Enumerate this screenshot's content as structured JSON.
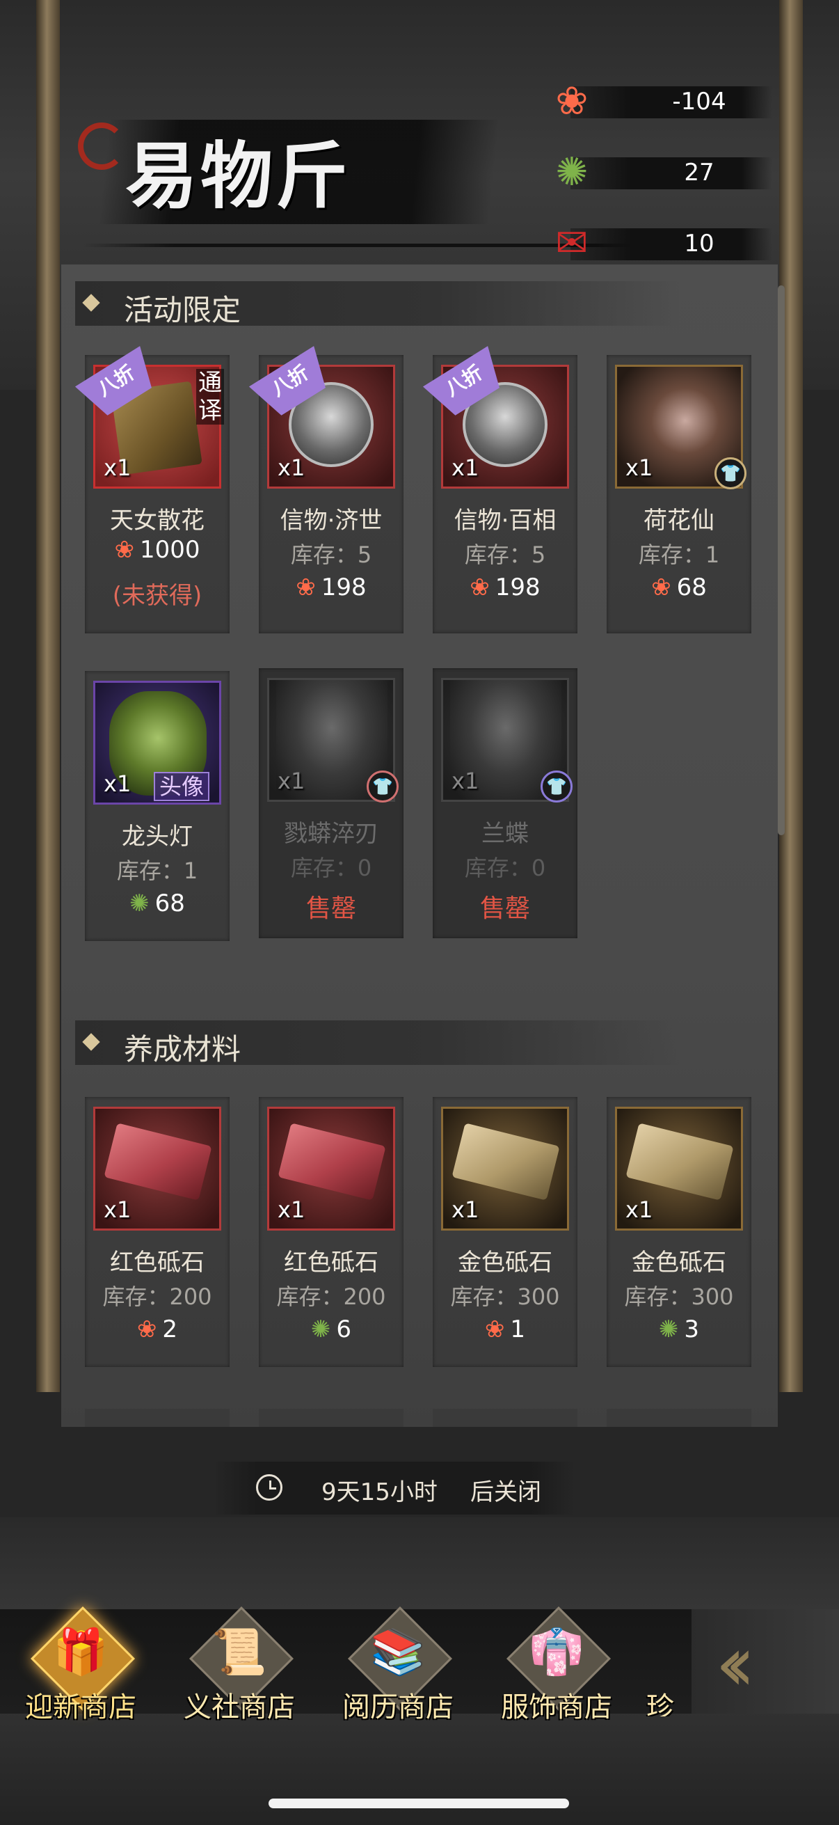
{
  "header": {
    "title": "易物斤"
  },
  "currencies": [
    {
      "icon": "lotus-icon",
      "value": "-104"
    },
    {
      "icon": "dragon-token-icon",
      "value": "27"
    },
    {
      "icon": "fortune-bag-icon",
      "value": "10"
    }
  ],
  "sections": {
    "limited": {
      "title": "活动限定"
    },
    "materials": {
      "title": "养成材料"
    }
  },
  "limited_items": [
    {
      "name": "天女散花",
      "qty": "x1",
      "badge": "八折",
      "side_label": "通译",
      "price": "1000",
      "currency": "lotus",
      "note": "(未获得)"
    },
    {
      "name": "信物·济世",
      "qty": "x1",
      "badge": "八折",
      "stock": "库存：5",
      "price": "198",
      "currency": "lotus"
    },
    {
      "name": "信物·百相",
      "qty": "x1",
      "badge": "八折",
      "stock": "库存：5",
      "price": "198",
      "currency": "lotus"
    },
    {
      "name": "荷花仙",
      "qty": "x1",
      "stock": "库存：1",
      "price": "68",
      "currency": "lotus"
    },
    {
      "name": "龙头灯",
      "qty": "x1",
      "tag": "头像",
      "stock": "库存：1",
      "price": "68",
      "currency": "dragon"
    },
    {
      "name": "戮蟒淬刃",
      "qty": "x1",
      "stock": "库存：0",
      "status": "售罄"
    },
    {
      "name": "兰蝶",
      "qty": "x1",
      "stock": "库存：0",
      "status": "售罄"
    }
  ],
  "material_items": [
    {
      "name": "红色砥石",
      "qty": "x1",
      "stock": "库存：200",
      "price": "2",
      "currency": "lotus"
    },
    {
      "name": "红色砥石",
      "qty": "x1",
      "stock": "库存：200",
      "price": "6",
      "currency": "dragon"
    },
    {
      "name": "金色砥石",
      "qty": "x1",
      "stock": "库存：300",
      "price": "1",
      "currency": "lotus"
    },
    {
      "name": "金色砥石",
      "qty": "x1",
      "stock": "库存：300",
      "price": "3",
      "currency": "dragon"
    }
  ],
  "timer": {
    "time": "9天15小时",
    "suffix": "后关闭"
  },
  "tabs": [
    {
      "label": "迎新商店",
      "active": true
    },
    {
      "label": "义社商店"
    },
    {
      "label": "阅历商店"
    },
    {
      "label": "服饰商店"
    },
    {
      "label": "珍"
    }
  ],
  "colors": {
    "accent_gold": "#ffe18a",
    "sold_out": "#e25545",
    "not_owned": "#e06a5a",
    "discount_badge": "#a07cd8"
  }
}
